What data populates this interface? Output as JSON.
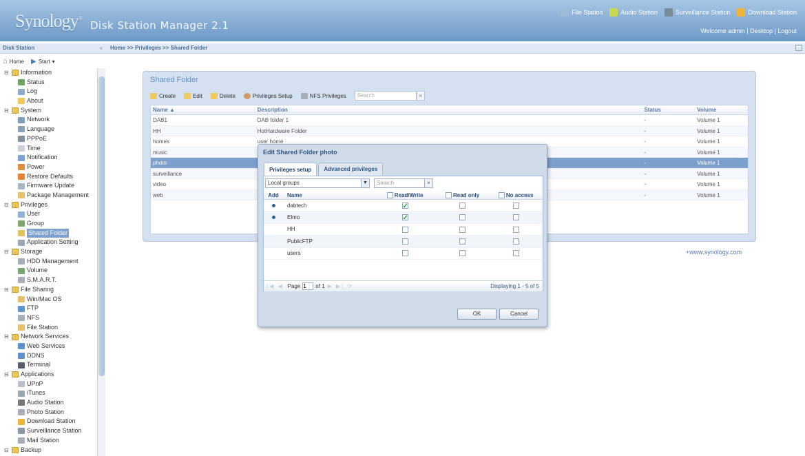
{
  "header": {
    "logo": "Synology",
    "product": "Disk Station Manager 2.1",
    "app_links": [
      {
        "label": "File Station",
        "icon": "file-station-icon",
        "color": "#9fbad6"
      },
      {
        "label": "Audio Station",
        "icon": "audio-station-icon",
        "color": "#c9d94e"
      },
      {
        "label": "Surveillance Station",
        "icon": "surveillance-station-icon",
        "color": "#7a8a99"
      },
      {
        "label": "Download Station",
        "icon": "download-station-icon",
        "color": "#f0b437"
      }
    ],
    "welcome": "Welcome admin",
    "desktop": "Desktop",
    "logout": "Logout"
  },
  "sidebar": {
    "title": "Disk Station",
    "home": "Home",
    "start": "Start",
    "items": [
      {
        "type": "cat",
        "label": "Information"
      },
      {
        "type": "leaf",
        "label": "Status",
        "color": "#6aa55c"
      },
      {
        "type": "leaf",
        "label": "Log",
        "color": "#8aa8c9"
      },
      {
        "type": "leaf",
        "label": "About",
        "color": "#f0c95a"
      },
      {
        "type": "cat",
        "label": "System"
      },
      {
        "type": "leaf",
        "label": "Network",
        "color": "#7d9dbb"
      },
      {
        "type": "leaf",
        "label": "Language",
        "color": "#8aa0b6"
      },
      {
        "type": "leaf",
        "label": "PPPoE",
        "color": "#7d8fa0"
      },
      {
        "type": "leaf",
        "label": "Time",
        "color": "#c9d1da"
      },
      {
        "type": "leaf",
        "label": "Notification",
        "color": "#7aa4cf"
      },
      {
        "type": "leaf",
        "label": "Power",
        "color": "#e08c3c"
      },
      {
        "type": "leaf",
        "label": "Restore Defaults",
        "color": "#e2863a"
      },
      {
        "type": "leaf",
        "label": "Firmware Update",
        "color": "#a6b4c3"
      },
      {
        "type": "leaf",
        "label": "Package Management",
        "color": "#e7c06b"
      },
      {
        "type": "cat",
        "label": "Privileges"
      },
      {
        "type": "leaf",
        "label": "User",
        "color": "#8fb2d6"
      },
      {
        "type": "leaf",
        "label": "Group",
        "color": "#7fa66e"
      },
      {
        "type": "leaf",
        "label": "Shared Folder",
        "color": "#e2c25d",
        "selected": true
      },
      {
        "type": "leaf",
        "label": "Application Setting",
        "color": "#9aa7b5"
      },
      {
        "type": "cat",
        "label": "Storage"
      },
      {
        "type": "leaf",
        "label": "HDD Management",
        "color": "#a5afb9"
      },
      {
        "type": "leaf",
        "label": "Volume",
        "color": "#74a66a"
      },
      {
        "type": "leaf",
        "label": "S.M.A.R.T.",
        "color": "#a5afb9"
      },
      {
        "type": "cat",
        "label": "File Sharing"
      },
      {
        "type": "leaf",
        "label": "Win/Mac OS",
        "color": "#e7c06b"
      },
      {
        "type": "leaf",
        "label": "FTP",
        "color": "#5d92cc"
      },
      {
        "type": "leaf",
        "label": "NFS",
        "color": "#a5afb9"
      },
      {
        "type": "leaf",
        "label": "File Station",
        "color": "#e7c06b"
      },
      {
        "type": "cat",
        "label": "Network Services"
      },
      {
        "type": "leaf",
        "label": "Web Services",
        "color": "#5d92cc"
      },
      {
        "type": "leaf",
        "label": "DDNS",
        "color": "#5d92cc"
      },
      {
        "type": "leaf",
        "label": "Terminal",
        "color": "#58606a"
      },
      {
        "type": "cat",
        "label": "Applications"
      },
      {
        "type": "leaf",
        "label": "UPnP",
        "color": "#b7bfc8"
      },
      {
        "type": "leaf",
        "label": "iTunes",
        "color": "#9aa7b5"
      },
      {
        "type": "leaf",
        "label": "Audio Station",
        "color": "#777"
      },
      {
        "type": "leaf",
        "label": "Photo Station",
        "color": "#a5afb9"
      },
      {
        "type": "leaf",
        "label": "Download Station",
        "color": "#f0b437"
      },
      {
        "type": "leaf",
        "label": "Surveillance Station",
        "color": "#8a96a3"
      },
      {
        "type": "leaf",
        "label": "Mail Station",
        "color": "#a5afb9"
      },
      {
        "type": "cat",
        "label": "Backup"
      }
    ]
  },
  "breadcrumb": "Home >> Privileges >> Shared Folder",
  "panel": {
    "title": "Shared Folder",
    "toolbar": {
      "create": "Create",
      "edit": "Edit",
      "delete": "Delete",
      "privileges_setup": "Privileges Setup",
      "nfs_privileges": "NFS Privileges",
      "search_placeholder": "Search"
    },
    "columns": [
      "Name ▲",
      "Description",
      "Status",
      "Volume"
    ],
    "rows": [
      [
        "DAB1",
        "DAB folder 1",
        "-",
        "Volume 1"
      ],
      [
        "HH",
        "HotHardware Folder",
        "-",
        "Volume 1"
      ],
      [
        "homes",
        "user home",
        "-",
        "Volume 1"
      ],
      [
        "music",
        "",
        "-",
        "Volume 1"
      ],
      [
        "photo",
        "",
        "-",
        "Volume 1"
      ],
      [
        "surveillance",
        "",
        "-",
        "Volume 1"
      ],
      [
        "video",
        "",
        "-",
        "Volume 1"
      ],
      [
        "web",
        "",
        "-",
        "Volume 1"
      ]
    ],
    "selected_row": 4
  },
  "footer_link": "+www.synology.com",
  "dialog": {
    "title": "Edit Shared Folder photo",
    "tabs": [
      "Privileges setup",
      "Advanced privileges"
    ],
    "group_select": "Local groups",
    "search_placeholder": "Search",
    "columns": {
      "add": "Add",
      "name": "Name",
      "rw": "Read/Write",
      "ro": "Read only",
      "na": "No access"
    },
    "rows": [
      {
        "added": true,
        "name": "dabtech",
        "rw": true,
        "ro": false,
        "na": false
      },
      {
        "added": true,
        "name": "Elmo",
        "rw": true,
        "ro": false,
        "na": false
      },
      {
        "added": false,
        "name": "HH",
        "rw": false,
        "ro": false,
        "na": false
      },
      {
        "added": false,
        "name": "PublicFTP",
        "rw": false,
        "ro": false,
        "na": false
      },
      {
        "added": false,
        "name": "users",
        "rw": false,
        "ro": false,
        "na": false
      }
    ],
    "pager": {
      "page_label": "Page",
      "page": "1",
      "of": "of 1",
      "info": "Displaying 1 - 5 of 5"
    },
    "ok": "OK",
    "cancel": "Cancel"
  }
}
